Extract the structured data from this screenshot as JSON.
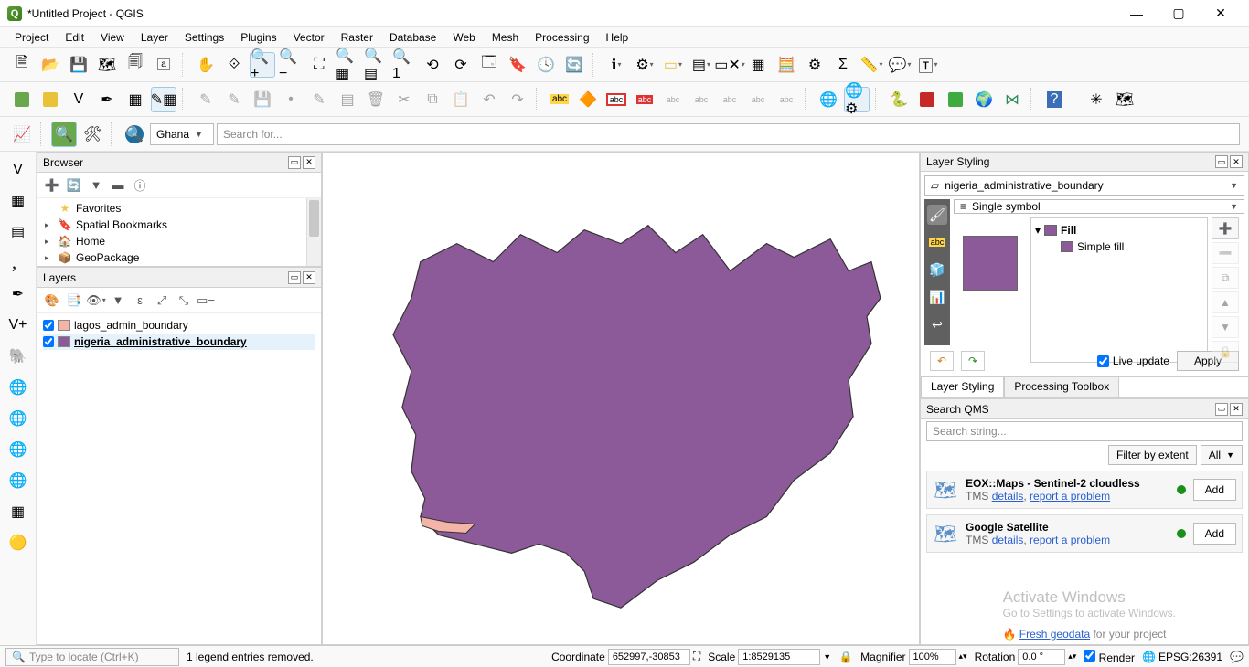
{
  "window": {
    "title": "*Untitled Project - QGIS"
  },
  "menu": [
    "Project",
    "Edit",
    "View",
    "Layer",
    "Settings",
    "Plugins",
    "Vector",
    "Raster",
    "Database",
    "Web",
    "Mesh",
    "Processing",
    "Help"
  ],
  "row3": {
    "combo": "Ghana",
    "search_placeholder": "Search for..."
  },
  "browser": {
    "title": "Browser",
    "items": [
      {
        "exp": "",
        "icon": "★",
        "label": "Favorites",
        "color": "#f2c744"
      },
      {
        "exp": "▶",
        "icon": "🔖",
        "label": "Spatial Bookmarks"
      },
      {
        "exp": "▶",
        "icon": "🏠",
        "label": "Home"
      },
      {
        "exp": "▶",
        "icon": "📦",
        "label": "GeoPackage"
      }
    ]
  },
  "layers": {
    "title": "Layers",
    "items": [
      {
        "checked": true,
        "color": "#f4b5a8",
        "name": "lagos_admin_boundary"
      },
      {
        "checked": true,
        "color": "#8d5a99",
        "name": "nigeria_administrative_boundary"
      }
    ],
    "selected_index": 1
  },
  "layer_styling": {
    "title": "Layer Styling",
    "layer": "nigeria_administrative_boundary",
    "renderer": "Single symbol",
    "tree": {
      "root": "Fill",
      "child": "Simple fill"
    },
    "live_update": true,
    "apply": "Apply",
    "tabs": [
      "Layer Styling",
      "Processing Toolbox"
    ],
    "active_tab": 0,
    "fill_color": "#8d5a99"
  },
  "qms": {
    "title": "Search QMS",
    "search_placeholder": "Search string...",
    "filter_extent": "Filter by extent",
    "filter_all": "All",
    "items": [
      {
        "title": "EOX::Maps - Sentinel-2 cloudless",
        "sub": "TMS",
        "details": "details",
        "report": "report a problem",
        "add": "Add"
      },
      {
        "title": "Google Satellite",
        "sub": "TMS",
        "details": "details",
        "report": "report a problem",
        "add": "Add"
      }
    ],
    "footer_link": "Fresh geodata",
    "footer_tail": " for your project"
  },
  "status": {
    "locate_placeholder": "Type to locate (Ctrl+K)",
    "message": "1 legend entries removed.",
    "coord_label": "Coordinate",
    "coord_value": "652997,-30853",
    "scale_label": "Scale",
    "scale_value": "1:8529135",
    "mag_label": "Magnifier",
    "mag_value": "100%",
    "rot_label": "Rotation",
    "rot_value": "0.0 °",
    "render": "Render",
    "crs": "EPSG:26391"
  },
  "watermark": {
    "line1": "Activate Windows",
    "line2": "Go to Settings to activate Windows."
  }
}
